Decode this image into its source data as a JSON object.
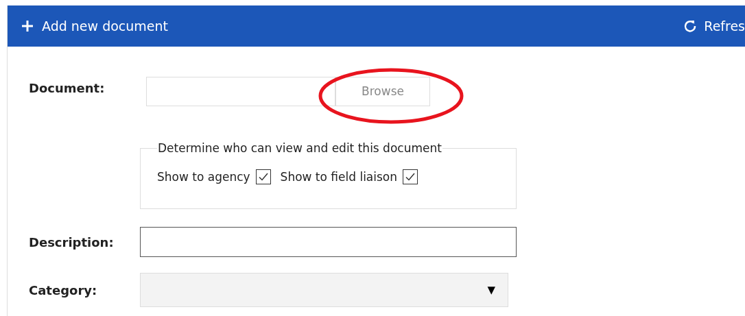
{
  "toolbar": {
    "add_button": {
      "label": "Add new document"
    },
    "refresh_button": {
      "label": "Refres"
    }
  },
  "form": {
    "document": {
      "label": "Document:",
      "browse_button": "Browse"
    },
    "visibility": {
      "legend": "Determine who can view and edit this document",
      "options": [
        {
          "label": "Show to agency",
          "checked": true
        },
        {
          "label": "Show to field liaison",
          "checked": true
        }
      ]
    },
    "description": {
      "label": "Description:"
    },
    "category": {
      "label": "Category:",
      "arrow": "▼"
    }
  }
}
